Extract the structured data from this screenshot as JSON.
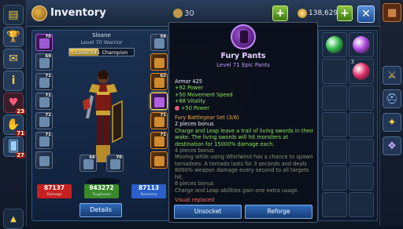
{
  "header": {
    "title": "Inventory",
    "gems": "30",
    "gold": "138,629",
    "plus_label": "+",
    "close_label": "✕"
  },
  "sidebar": {
    "badges": {
      "heart": "23",
      "hand": "71",
      "cards": "27"
    }
  },
  "character": {
    "name": "Sloane",
    "level_text": "Level 70 Warrior",
    "champion_text": "Level 141 Champion",
    "champion_progress": 0.45,
    "left_slots": [
      {
        "level": "70",
        "rarity": "purple",
        "icon": "helmet-icon"
      },
      {
        "level": "69",
        "rarity": "normal",
        "icon": "amulet-icon"
      },
      {
        "level": "71",
        "rarity": "normal",
        "icon": "chest-armor-icon"
      },
      {
        "level": "71",
        "rarity": "normal",
        "icon": "belt-icon"
      },
      {
        "level": "71",
        "rarity": "normal",
        "icon": "gloves-icon"
      },
      {
        "level": "71",
        "rarity": "normal",
        "icon": "ring-icon"
      },
      {
        "level": "",
        "rarity": "normal",
        "icon": "potion-icon"
      }
    ],
    "right_slots": [
      {
        "level": "59",
        "rarity": "normal",
        "icon": "sword-icon"
      },
      {
        "level": "",
        "rarity": "orange",
        "icon": "bracer-icon"
      },
      {
        "level": "62",
        "rarity": "orange",
        "icon": "cloak-icon"
      },
      {
        "level": "",
        "rarity": "selected",
        "icon": "pants-icon"
      },
      {
        "level": "71",
        "rarity": "orange",
        "icon": "boots-icon"
      },
      {
        "level": "71",
        "rarity": "orange",
        "icon": "ring-icon"
      },
      {
        "level": "",
        "rarity": "orange",
        "icon": "relic-icon"
      }
    ],
    "bottom_slots": [
      {
        "level": "66",
        "rarity": "normal",
        "icon": "axe-icon"
      },
      {
        "level": "70",
        "rarity": "normal",
        "icon": "shield-icon"
      }
    ],
    "stats": [
      {
        "value": "87137",
        "label": "Damage",
        "color": "#c82020"
      },
      {
        "value": "943272",
        "label": "Toughness",
        "color": "#3a8a2a"
      },
      {
        "value": "87113",
        "label": "Recovery",
        "color": "#2a5ec8"
      }
    ],
    "details_label": "Details"
  },
  "tooltip": {
    "name": "Fury Pants",
    "subtitle": "Level 71 Epic Pants",
    "lines": [
      {
        "text": "Armor 425",
        "cls": "white"
      },
      {
        "text": "+92 Power",
        "cls": "green"
      },
      {
        "text": "+50 Movement Speed",
        "cls": "green"
      },
      {
        "text": "+88 Vitality",
        "cls": "green"
      },
      {
        "text": "+50 Power",
        "cls": "green",
        "dot": true
      },
      {
        "text": "",
        "cls": "white"
      },
      {
        "text": "Fury Battlegear Set (3/6)",
        "cls": "orange"
      },
      {
        "text": "2 pieces bonus",
        "cls": "white"
      },
      {
        "text": "Charge and Leap leave a trail of living swords in their wake. The living swords will hit monsters at destination for 15000% damage each.",
        "cls": "green"
      },
      {
        "text": "4 pieces bonus",
        "cls": "dim"
      },
      {
        "text": "Moving while using Whirlwind has a chance to spawn tornadoes. A tornado lasts for 3 seconds and deals 8000% weapon damage every second to all targets hit.",
        "cls": "dim"
      },
      {
        "text": "6 pieces bonus",
        "cls": "dim"
      },
      {
        "text": "Charge and Leap abilities gain one extra usage.",
        "cls": "dim"
      },
      {
        "text": "",
        "cls": "white"
      },
      {
        "text": "Visual replaced",
        "cls": "red"
      }
    ],
    "unsocket_label": "Unsocket",
    "reforge_label": "Reforge"
  },
  "grid": {
    "cells": [
      {
        "color": "#2fb84a",
        "count": ""
      },
      {
        "color": "#b04ae0",
        "count": ""
      },
      {
        "color": "",
        "count": ""
      },
      {
        "color": "#e0306a",
        "count": "3"
      }
    ]
  }
}
